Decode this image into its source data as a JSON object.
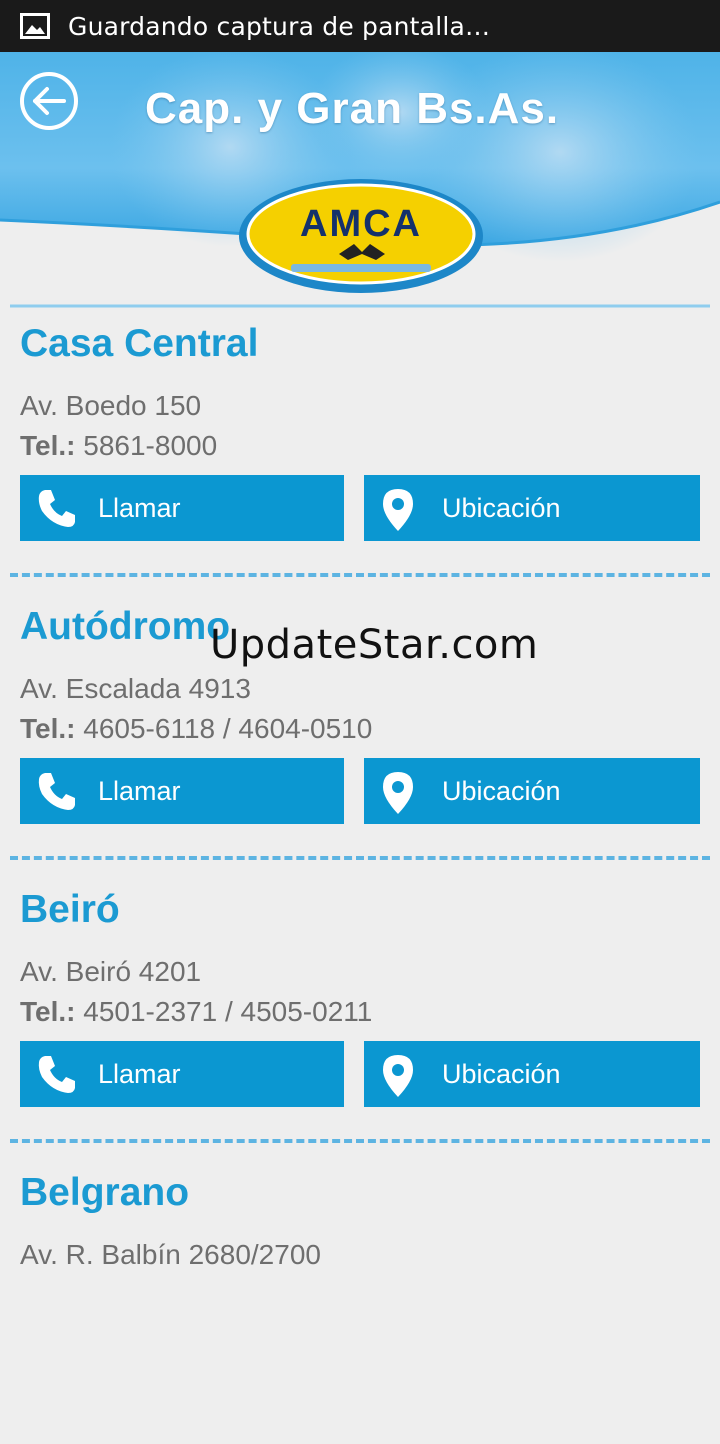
{
  "status_bar": {
    "text": "Guardando captura de pantalla…"
  },
  "header": {
    "title": "Cap. y Gran Bs.As.",
    "logo_text": "AMCA"
  },
  "branches": [
    {
      "name": "Casa Central",
      "address": "Av. Boedo 150",
      "tel_label": "Tel.:",
      "tel": "5861-8000",
      "call_label": "Llamar",
      "location_label": "Ubicación"
    },
    {
      "name": "Autódromo",
      "address": "Av. Escalada 4913",
      "tel_label": "Tel.:",
      "tel": "4605-6118 / 4604-0510",
      "call_label": "Llamar",
      "location_label": "Ubicación"
    },
    {
      "name": "Beiró",
      "address": "Av. Beiró 4201",
      "tel_label": "Tel.:",
      "tel": "4501-2371 / 4505-0211",
      "call_label": "Llamar",
      "location_label": "Ubicación"
    },
    {
      "name": "Belgrano",
      "address": "Av. R. Balbín 2680/2700"
    }
  ],
  "watermark": "UpdateStar.com",
  "colors": {
    "accent": "#0b97d1",
    "title": "#1b9ad2",
    "divider": "#5db4e2",
    "status_bar": "#1a1a1a",
    "logo_yellow": "#f5d000"
  },
  "icons": [
    "image-icon",
    "back-arrow-icon",
    "phone-icon",
    "location-pin-icon"
  ]
}
